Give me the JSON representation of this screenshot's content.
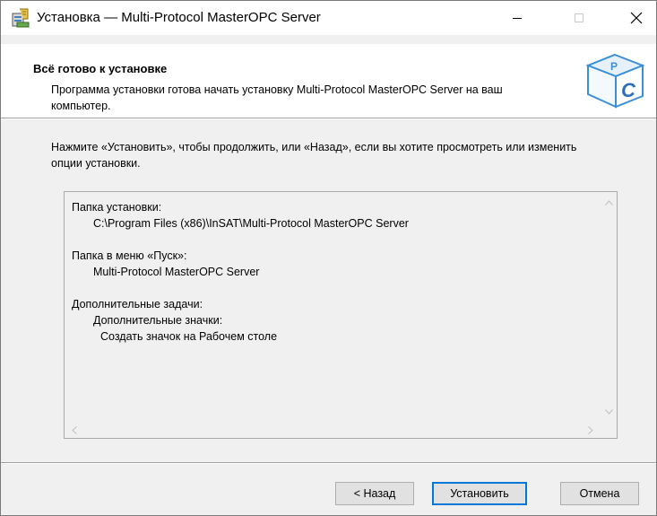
{
  "window": {
    "title": "Установка — Multi-Protocol MasterOPC Server",
    "icon": "installer-icon",
    "controls": [
      "minimize",
      "maximize",
      "close"
    ]
  },
  "header": {
    "title": "Всё готово к установке",
    "subtitle": "Программа установки готова начать установку Multi-Protocol MasterOPC Server на ваш компьютер.",
    "logo_letters": [
      "P",
      "C"
    ]
  },
  "body": {
    "instructions": "Нажмите «Установить», чтобы продолжить, или «Назад», если вы хотите просмотреть или изменить опции установки.",
    "memo": {
      "install_folder_label": "Папка установки:",
      "install_folder_value": "C:\\Program Files (x86)\\InSAT\\Multi-Protocol MasterOPC Server",
      "start_menu_label": "Папка в меню «Пуск»:",
      "start_menu_value": "Multi-Protocol MasterOPC Server",
      "tasks_label": "Дополнительные задачи:",
      "tasks_group": "Дополнительные значки:",
      "tasks_item": "Создать значок на Рабочем столе"
    }
  },
  "buttons": {
    "back": "< Назад",
    "install": "Установить",
    "cancel": "Отмена"
  },
  "colors": {
    "focus_border": "#0078d7",
    "logo_blue": "#3a8fd8"
  }
}
